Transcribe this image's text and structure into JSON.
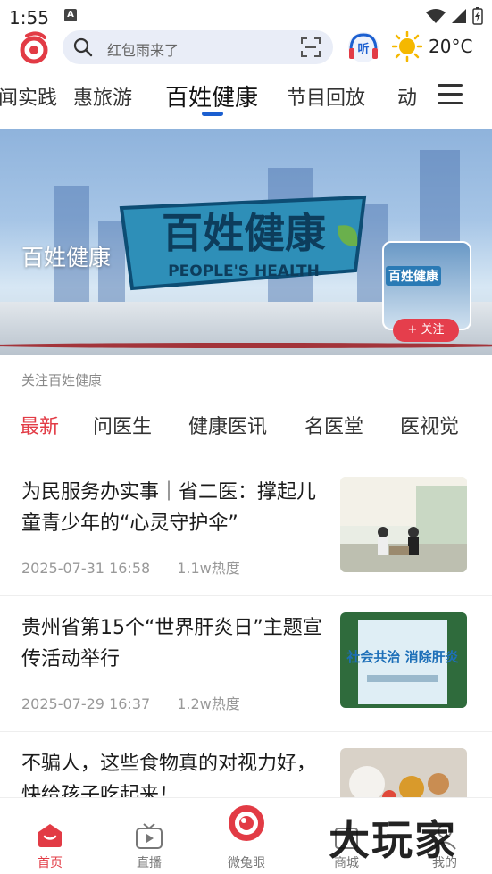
{
  "status": {
    "time": "1:55",
    "notification_icon": "A"
  },
  "topbar": {
    "search_placeholder": "红包雨来了",
    "listen_label": "听",
    "temperature": "20°C",
    "accent_color": "#e23b45"
  },
  "channel_tabs": [
    {
      "label": "闻实践"
    },
    {
      "label": "惠旅游"
    },
    {
      "label": "百姓健康"
    },
    {
      "label": "节目回放"
    },
    {
      "label": "动"
    }
  ],
  "banner": {
    "title": "百姓健康",
    "logo_text": "百姓健康",
    "logo_sub": "PEOPLE'S HEALTH",
    "follow_label": "+ 关注"
  },
  "follow_section": {
    "label": "关注百姓健康"
  },
  "sub_tabs": [
    {
      "label": "最新"
    },
    {
      "label": "问医生"
    },
    {
      "label": "健康医讯"
    },
    {
      "label": "名医堂"
    },
    {
      "label": "医视觉"
    }
  ],
  "news": [
    {
      "title": "为民服务办实事｜省二医：撑起儿童青少年的“心灵守护伞”",
      "date": "2025-07-31 16:58",
      "heat": "1.1w热度"
    },
    {
      "title": "贵州省第15个“世界肝炎日”主题宣传活动举行",
      "date": "2025-07-29 16:37",
      "heat": "1.2w热度",
      "image_text": "社会共治 消除肝炎"
    },
    {
      "title": "不骗人，这些食物真的对视力好，快给孩子吃起来！",
      "date": "",
      "heat": ""
    }
  ],
  "bottom_nav": [
    {
      "label": "首页"
    },
    {
      "label": "直播"
    },
    {
      "label": "微兔眼"
    },
    {
      "label": "商城"
    },
    {
      "label": "我的"
    }
  ],
  "watermark": "大玩家"
}
